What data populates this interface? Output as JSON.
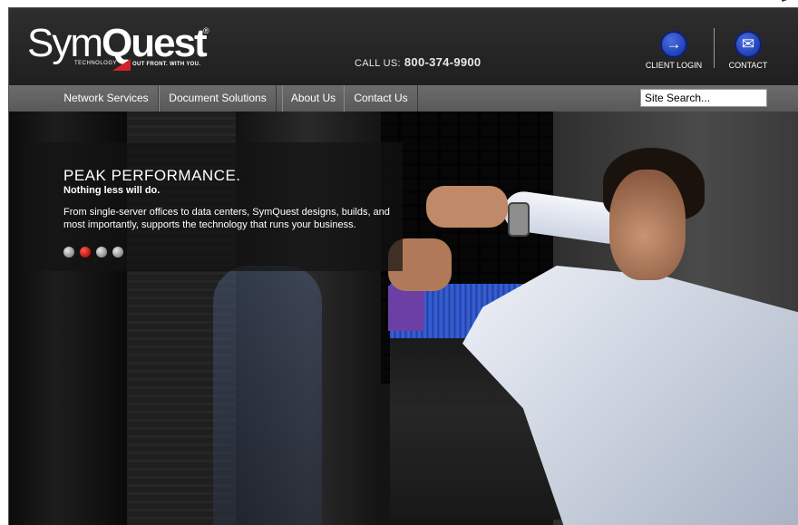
{
  "brand": {
    "name_regular": "Sym",
    "name_bold": "Quest",
    "registered": "®",
    "tech": "TECHNOLOGY",
    "tagline": "OUT FRONT. WITH YOU."
  },
  "header": {
    "call_label": "CALL US:",
    "call_number": "800-374-9900",
    "client_login": "CLIENT LOGIN",
    "client_login_icon": "→",
    "contact": "CONTACT",
    "contact_icon": "✉"
  },
  "nav": {
    "items": [
      {
        "label": "Network Services"
      },
      {
        "label": "Document Solutions"
      },
      {
        "label": "About Us"
      },
      {
        "label": "Contact Us"
      }
    ],
    "search_value": "Site Search..."
  },
  "hero": {
    "title": "PEAK PERFORMANCE.",
    "subtitle": "Nothing less will do.",
    "body": "From single-server offices to data centers, SymQuest designs, builds, and most importantly, supports the technology that runs your business.",
    "slides": 4,
    "active_slide": 2,
    "colors": {
      "accent": "#d2232a",
      "icon_blue": "#1b3cb0"
    }
  }
}
